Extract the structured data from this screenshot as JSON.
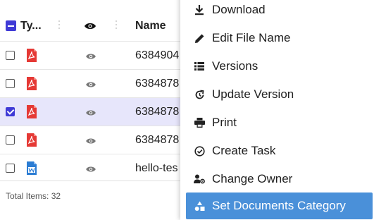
{
  "table": {
    "header": {
      "type_label": "Ty...",
      "name_label": "Name"
    },
    "rows": [
      {
        "icon": "pdf-icon",
        "name": "6384904",
        "checked": false
      },
      {
        "icon": "pdf-icon",
        "name": "6384878",
        "checked": false
      },
      {
        "icon": "pdf-icon",
        "name": "6384878",
        "checked": true
      },
      {
        "icon": "pdf-icon",
        "name": "6384878",
        "checked": false
      },
      {
        "icon": "word-doc-icon",
        "name": "hello-tes",
        "checked": false
      }
    ],
    "total_items": "Total Items: 32"
  },
  "menu": {
    "items": [
      {
        "icon": "download-icon",
        "label": "Download"
      },
      {
        "icon": "pencil-icon",
        "label": "Edit File Name"
      },
      {
        "icon": "list-icon",
        "label": "Versions"
      },
      {
        "icon": "update-icon",
        "label": "Update Version"
      },
      {
        "icon": "printer-icon",
        "label": "Print"
      },
      {
        "icon": "task-check-icon",
        "label": "Create Task"
      },
      {
        "icon": "user-gear-icon",
        "label": "Change Owner"
      },
      {
        "icon": "category-shapes-icon",
        "label": "Set Documents Category"
      }
    ],
    "active_index": 7
  },
  "colors": {
    "accent": "#3f3ad6",
    "selected_row": "#e7e6fb",
    "menu_active": "#4a90d9",
    "pdf_red": "#e53935",
    "word_blue": "#2b7cd3"
  }
}
